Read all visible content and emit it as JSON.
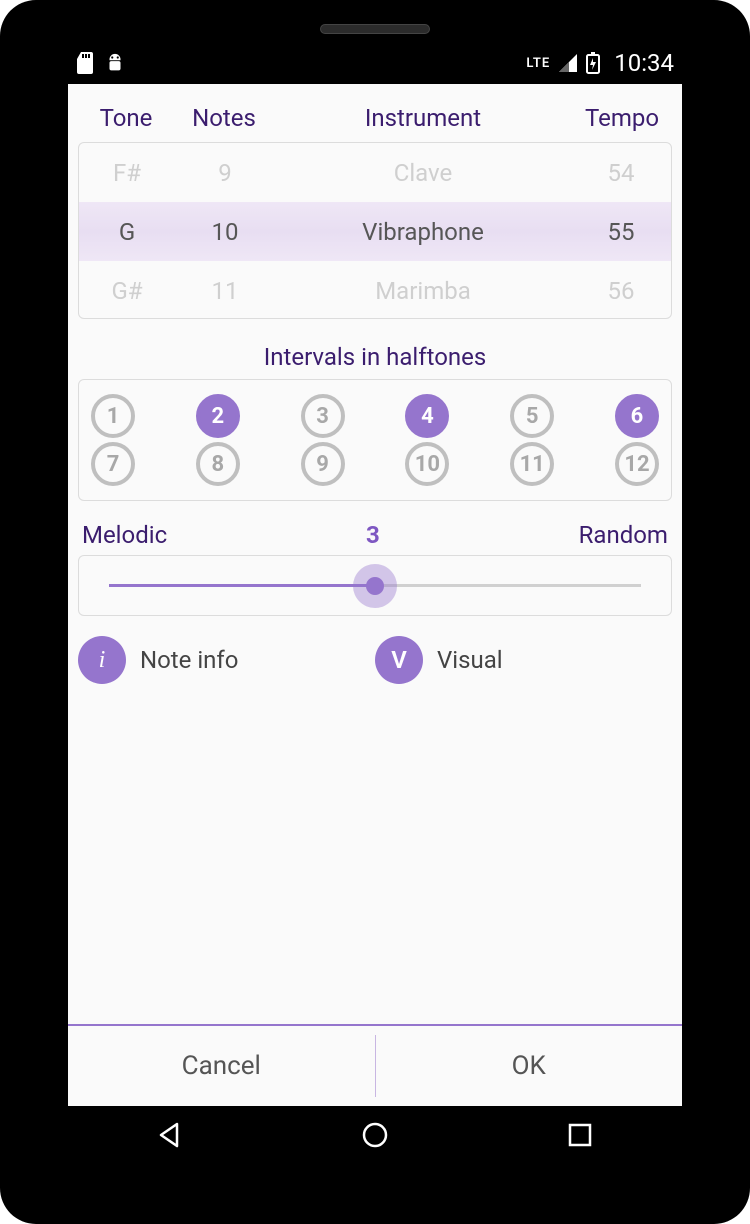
{
  "status": {
    "time": "10:34",
    "net": "LTE"
  },
  "headers": {
    "tone": "Tone",
    "notes": "Notes",
    "instrument": "Instrument",
    "tempo": "Tempo"
  },
  "picker": {
    "prev": {
      "tone": "F#",
      "notes": "9",
      "instrument": "Clave",
      "tempo": "54"
    },
    "sel": {
      "tone": "G",
      "notes": "10",
      "instrument": "Vibraphone",
      "tempo": "55"
    },
    "next": {
      "tone": "G#",
      "notes": "11",
      "instrument": "Marimba",
      "tempo": "56"
    }
  },
  "intervals": {
    "label": "Intervals in halftones",
    "items": [
      "1",
      "2",
      "3",
      "4",
      "5",
      "6",
      "7",
      "8",
      "9",
      "10",
      "11",
      "12"
    ],
    "selected": [
      2,
      4,
      6
    ]
  },
  "slider": {
    "left": "Melodic",
    "right": "Random",
    "value": "3",
    "percent": 50
  },
  "options": {
    "info": {
      "badge": "i",
      "label": "Note info"
    },
    "visual": {
      "badge": "V",
      "label": "Visual"
    }
  },
  "footer": {
    "cancel": "Cancel",
    "ok": "OK"
  }
}
